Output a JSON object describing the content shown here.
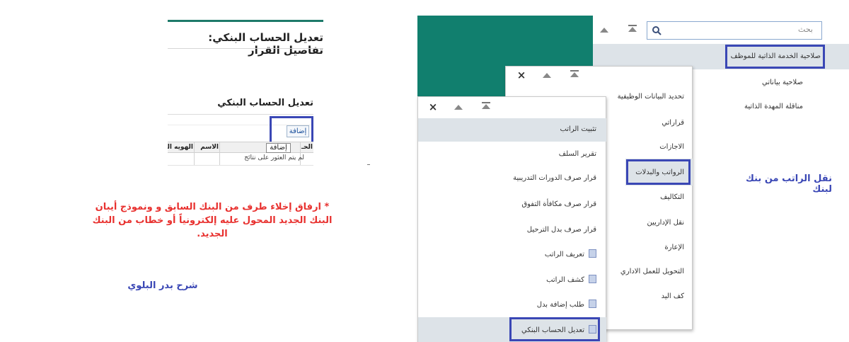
{
  "colors": {
    "teal": "#117f6e",
    "highlight_border": "#3a47b5",
    "note_red": "#e8312f",
    "selected_row": "#dde3e8"
  },
  "bank_edit": {
    "page_title": "تعديل الحساب البنكي: تفاصيل القرار",
    "section_title": "تعديل الحساب البنكي",
    "add_button": "إضافة",
    "add_tooltip": "إضافة",
    "columns": [
      "الحـ",
      "الاسم",
      "الهويه الو"
    ],
    "no_results": "لم يتم العثور على نتائج",
    "note": "* ارفاق إخلاء طرف من البنك السابق و ونموذج أيبان البنك الجديد المحول عليه إلكترونياً أو خطاب من البنك الجديد.",
    "author": "شرح بدر البلوي"
  },
  "menu_level1": {
    "search_placeholder": "بحث",
    "search_icon": "search-icon",
    "items": [
      "صلاحية الخدمة الذاتية للموظف",
      "صلاحية بياناتي",
      "مناقلة المهدة الذاتية"
    ]
  },
  "menu_level2": {
    "items": [
      "تحديد البيانات الوظيفية",
      "قراراتي",
      "الاجازات",
      "الرواتب والبدلات",
      "التكاليف",
      "نقل الإداريين",
      "الإعارة",
      "التحويل للعمل الاداري",
      "كف اليد"
    ]
  },
  "menu_level3": {
    "items": [
      "تثبيت الراتب",
      "تقرير السلف",
      "قرار صرف الدورات التدريبية",
      "قرار صرف مكافأة التفوق",
      "قرار صرف بدل الترحيل",
      "تعريف الراتب",
      "كشف الراتب",
      "طلب إضافة بدل",
      "تعديل الحساب البنكي"
    ]
  },
  "caption": "نقل الراتب من بنك لبنك"
}
